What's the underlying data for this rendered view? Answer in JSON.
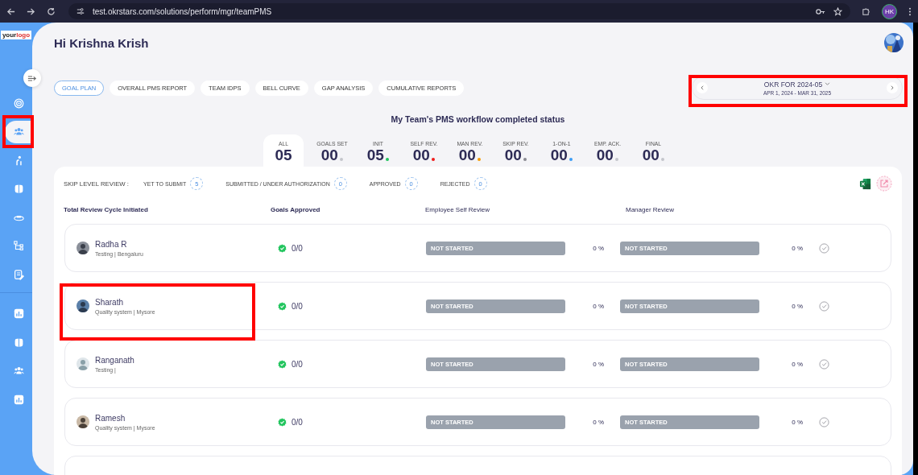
{
  "browser": {
    "url": "test.okrstars.com/solutions/perform/mgr/teamPMS",
    "profile": "HK"
  },
  "logo": {
    "first": "your",
    "second": "logo"
  },
  "sidebar": {
    "top_items": [
      {
        "selected": false
      },
      {
        "selected": true
      },
      {
        "selected": false
      },
      {
        "selected": false
      },
      {
        "selected": false
      },
      {
        "selected": false
      },
      {
        "selected": false
      }
    ],
    "bottom_items": [
      {
        "selected": false
      },
      {
        "selected": false
      },
      {
        "selected": false
      },
      {
        "selected": false
      }
    ]
  },
  "greeting": "Hi Krishna Krish",
  "tabs": [
    {
      "label": "GOAL PLAN",
      "selected": true
    },
    {
      "label": "OVERALL PMS REPORT",
      "selected": false
    },
    {
      "label": "TEAM IDPS",
      "selected": false
    },
    {
      "label": "BELL CURVE",
      "selected": false
    },
    {
      "label": "GAP ANALYSIS",
      "selected": false
    },
    {
      "label": "CUMULATIVE REPORTS",
      "selected": false
    }
  ],
  "period": {
    "title": "OKR FOR 2024-05",
    "range": "APR 1, 2024 - MAR 31, 2025"
  },
  "status_heading": "My Team's PMS workflow completed status",
  "stats": [
    {
      "label": "ALL",
      "value": "05",
      "selected": true
    },
    {
      "label": "GOALS SET",
      "value": "00",
      "selected": false,
      "color": "#c4c6cc"
    },
    {
      "label": "INIT",
      "value": "05",
      "selected": false,
      "color": "#22c55e"
    },
    {
      "label": "SELF REV.",
      "value": "00",
      "selected": false,
      "color": "#ef1c1c"
    },
    {
      "label": "MAN REV.",
      "value": "00",
      "selected": false,
      "color": "#f59e0b"
    },
    {
      "label": "SKIP REV.",
      "value": "00",
      "selected": false,
      "color": "#8a8a92"
    },
    {
      "label": "1-ON-1",
      "value": "00",
      "selected": false,
      "color": "#3b9cf5"
    },
    {
      "label": "EMP. ACK.",
      "value": "00",
      "selected": false,
      "color": "#c4c6cc"
    },
    {
      "label": "FINAL",
      "value": "00",
      "selected": false,
      "color": "#c4c6cc"
    }
  ],
  "skip_level": {
    "label": "SKIP LEVEL REVIEW :",
    "items": [
      {
        "label": "YET TO SUBMIT",
        "count": "5"
      },
      {
        "label": "SUBMITTED / UNDER AUTHORIZATION",
        "count": "0"
      },
      {
        "label": "APPROVED",
        "count": "0"
      },
      {
        "label": "REJECTED",
        "count": "0"
      }
    ]
  },
  "table": {
    "columns": [
      "Total Review Cycle Initiated",
      "Goals Approved",
      "Employee Self Review",
      "Manager Review"
    ],
    "rows": [
      {
        "name": "Radha R",
        "detail": "Testing | Bengaluru",
        "goals": "0/0",
        "self_status": "NOT STARTED",
        "self_percent": "0 %",
        "manager_status": "NOT STARTED",
        "manager_percent": "0 %"
      },
      {
        "name": "Sharath",
        "detail": "Quality system | Mysore",
        "goals": "0/0",
        "self_status": "NOT STARTED",
        "self_percent": "0 %",
        "manager_status": "NOT STARTED",
        "manager_percent": "0 %"
      },
      {
        "name": "Ranganath",
        "detail": "Testing |",
        "goals": "0/0",
        "self_status": "NOT STARTED",
        "self_percent": "0 %",
        "manager_status": "NOT STARTED",
        "manager_percent": "0 %"
      },
      {
        "name": "Ramesh",
        "detail": "Quality system | Mysore",
        "goals": "0/0",
        "self_status": "NOT STARTED",
        "self_percent": "0 %",
        "manager_status": "NOT STARTED",
        "manager_percent": "0 %"
      }
    ]
  }
}
